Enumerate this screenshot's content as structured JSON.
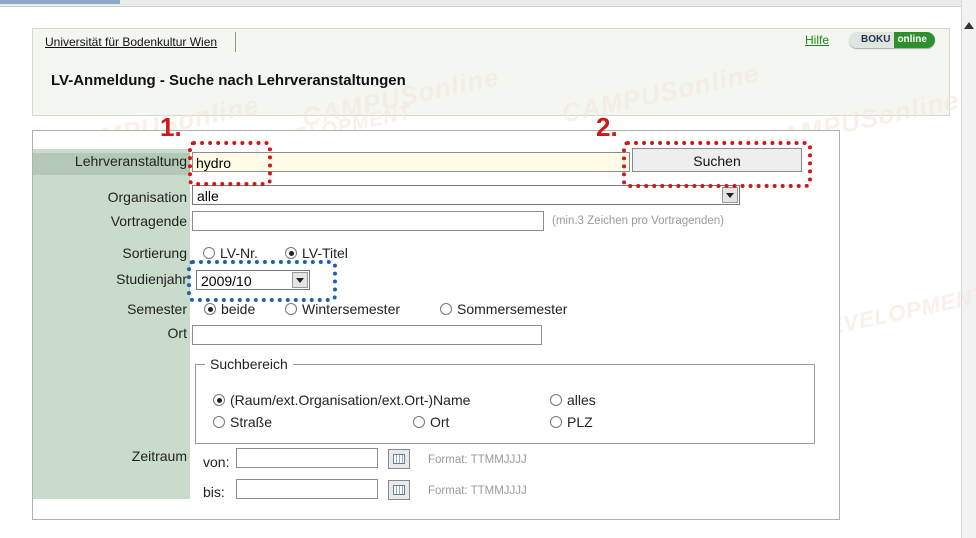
{
  "header": {
    "university": "Universität für Bodenkultur Wien",
    "help": "Hilfe",
    "badge_boku": "BOKU",
    "badge_online": "online",
    "title": "LV-Anmeldung - Suche nach Lehrveranstaltungen"
  },
  "watermark": "CAMPUSonline",
  "watermark2": "DEVELOPMENT",
  "form": {
    "lv_label": "Lehrveranstaltung",
    "lv_value": "hydro",
    "search_button": "Suchen",
    "org_label": "Organisation",
    "org_value": "alle",
    "lecturer_label": "Vortragende",
    "lecturer_value": "",
    "lecturer_hint": "(min.3 Zeichen pro Vortragenden)",
    "sort_label": "Sortierung",
    "sort_options": [
      "LV-Nr.",
      "LV-Titel"
    ],
    "sort_selected": "LV-Titel",
    "year_label": "Studienjahr",
    "year_value": "2009/10",
    "semester_label": "Semester",
    "semester_options": [
      "beide",
      "Wintersemester",
      "Sommersemester"
    ],
    "semester_selected": "beide",
    "place_label": "Ort",
    "place_value": "",
    "scope_legend": "Suchbereich",
    "scope_options": [
      "(Raum/ext.Organisation/ext.Ort-)Name",
      "alles",
      "Straße",
      "Ort",
      "PLZ"
    ],
    "scope_selected": "(Raum/ext.Organisation/ext.Ort-)Name",
    "period_label": "Zeitraum",
    "from_label": "von:",
    "to_label": "bis:",
    "from_value": "",
    "to_value": "",
    "date_format": "Format: TTMMJJJJ"
  },
  "annotations": {
    "step1": "1.",
    "step2": "2.",
    "red_color": "#d01818",
    "blue_color": "#1f5fb8"
  }
}
